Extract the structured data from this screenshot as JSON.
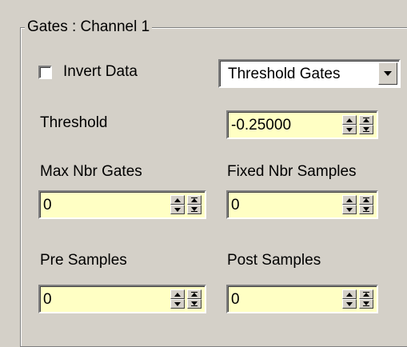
{
  "group": {
    "title": "Gates : Channel 1"
  },
  "invert_data": {
    "label": "Invert Data",
    "checked": false
  },
  "gate_mode": {
    "selected": "Threshold Gates"
  },
  "threshold": {
    "label": "Threshold",
    "value": "-0.25000"
  },
  "max_nbr_gates": {
    "label": "Max Nbr Gates",
    "value": "0"
  },
  "fixed_nbr_samples": {
    "label": "Fixed Nbr Samples",
    "value": "0"
  },
  "pre_samples": {
    "label": "Pre Samples",
    "value": "0"
  },
  "post_samples": {
    "label": "Post Samples",
    "value": "0"
  },
  "colors": {
    "panel": "#d4d0c8",
    "field_yellow": "#ffffc4",
    "field_white": "#ffffff"
  },
  "icons": {
    "spin": [
      "spin-up-icon",
      "spin-down-icon",
      "fast-up-icon",
      "fast-down-icon"
    ],
    "dropdown": "chevron-down-icon"
  }
}
